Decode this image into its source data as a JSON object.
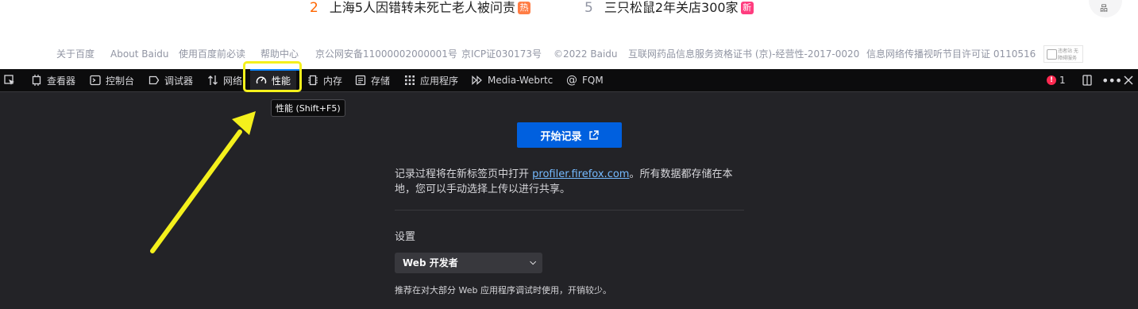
{
  "baidu": {
    "hot_items": [
      {
        "num": "2",
        "text": "上海5人因错转未死亡老人被问责",
        "badge": "热",
        "badge_color": "#ff7d45"
      },
      {
        "num": "5",
        "text": "三只松鼠2年关店300家",
        "badge": "新",
        "badge_color": "#ff3d7f"
      }
    ],
    "footer_links": [
      "关于百度",
      "About Baidu",
      "使用百度前必读",
      "帮助中心",
      "京公网安备11000002000001号",
      "京ICP证030173号",
      "©2022 Baidu",
      "互联网药品信息服务资格证书 (京)-经营性-2017-0020",
      "信息网络传播视听节目许可证 0110516"
    ],
    "footer_logo_text": "违者站 无障碍服务",
    "top_right_label": "品"
  },
  "devtools": {
    "tabs": [
      {
        "label": "",
        "icon": "pick-element-icon"
      },
      {
        "label": "查看器",
        "icon": "inspector-icon"
      },
      {
        "label": "控制台",
        "icon": "console-icon"
      },
      {
        "label": "调试器",
        "icon": "debugger-icon"
      },
      {
        "label": "网络",
        "icon": "network-icon"
      },
      {
        "label": "性能",
        "icon": "performance-icon"
      },
      {
        "label": "内存",
        "icon": "memory-icon"
      },
      {
        "label": "存储",
        "icon": "storage-icon"
      },
      {
        "label": "应用程序",
        "icon": "application-icon"
      },
      {
        "label": "Media-Webrtc",
        "icon": "media-icon"
      },
      {
        "label": "FQM",
        "icon": "fqm-icon"
      }
    ],
    "active_tab": "性能",
    "error_count": "1",
    "tooltip": "性能 (Shift+F5)",
    "start_button": "开始记录",
    "description_prefix": "记录过程将在新标签页中打开 ",
    "description_link": "profiler.firefox.com",
    "description_suffix": "。所有数据都存储在本地，您可以手动选择上传以进行共享。",
    "settings_label": "设置",
    "preset_value": "Web 开发者",
    "preset_description": "推荐在对大部分 Web 应用程序调试时使用，开销较少。"
  },
  "colors": {
    "accent": "#0060df",
    "annotation": "#f4f01c",
    "link": "#75baff",
    "error": "#ff2a51"
  }
}
